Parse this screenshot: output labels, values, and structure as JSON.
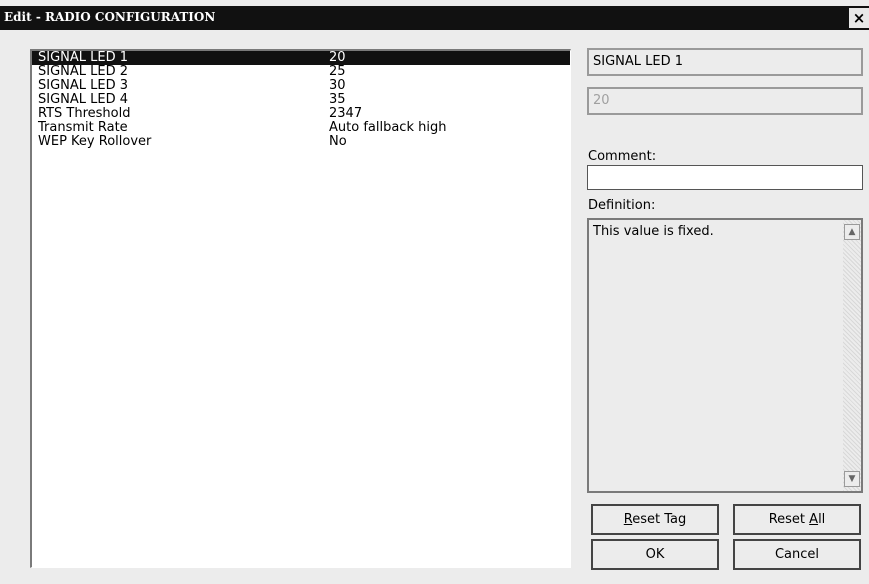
{
  "window": {
    "title": "Edit - RADIO CONFIGURATION",
    "close_label": "×"
  },
  "parameters": [
    {
      "name": "SIGNAL LED 1",
      "value": "20"
    },
    {
      "name": "SIGNAL LED 2",
      "value": "25"
    },
    {
      "name": "SIGNAL LED 3",
      "value": "30"
    },
    {
      "name": "SIGNAL LED 4",
      "value": "35"
    },
    {
      "name": "RTS Threshold",
      "value": "2347"
    },
    {
      "name": "Transmit Rate",
      "value": "Auto fallback high"
    },
    {
      "name": "WEP Key Rollover",
      "value": "No"
    }
  ],
  "detail": {
    "tag_name": "SIGNAL LED 1",
    "tag_value": "20",
    "comment_label": "Comment:",
    "comment_value": "",
    "definition_label": "Definition:",
    "definition_text": "This value is fixed."
  },
  "buttons": {
    "reset_tag": {
      "first": "R",
      "rest": "eset Tag"
    },
    "reset_all": {
      "before": "Reset ",
      "underlined": "A",
      "after": "ll"
    },
    "ok": "OK",
    "cancel": "Cancel"
  }
}
